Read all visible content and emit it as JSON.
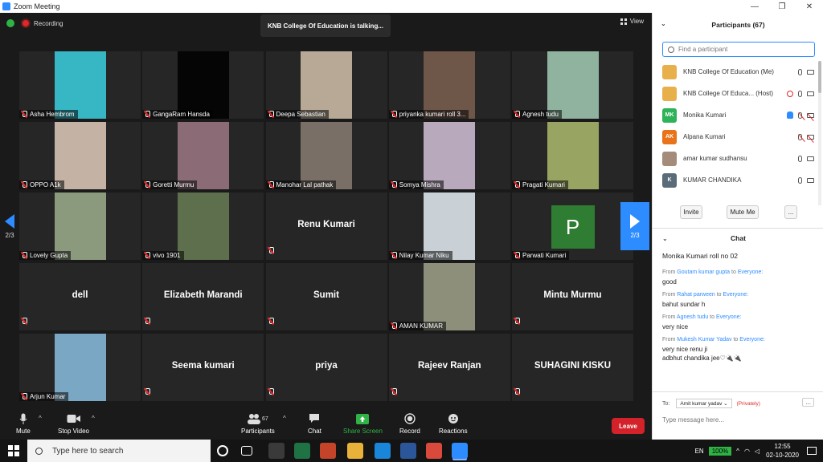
{
  "window": {
    "title": "Zoom Meeting",
    "controls": [
      "—",
      "❐",
      "✕"
    ]
  },
  "status": {
    "recording": "Recording",
    "talking": "KNB College Of Education is talking...",
    "view": "View"
  },
  "tiles": [
    {
      "name": "Asha Hembrom",
      "type": "video",
      "color": "#37b6c4"
    },
    {
      "name": "GangaRam Hansda",
      "type": "video",
      "color": "#050505"
    },
    {
      "name": "Deepa Sebastian",
      "type": "video",
      "color": "#b7a996"
    },
    {
      "name": "priyanka kumari roll 3...",
      "type": "video",
      "color": "#6e5648"
    },
    {
      "name": "Agnesh tudu",
      "type": "video",
      "color": "#8fb39e"
    },
    {
      "name": "OPPO A1k",
      "type": "video",
      "color": "#c4b3a5"
    },
    {
      "name": "Goretti Murmu",
      "type": "video",
      "color": "#8b6c76"
    },
    {
      "name": "Manohar Lal pathak",
      "type": "video",
      "color": "#7a6f66"
    },
    {
      "name": "Somya Mishra",
      "type": "video",
      "color": "#b9a9bd"
    },
    {
      "name": "Pragati Kumari",
      "type": "video",
      "color": "#98a461"
    },
    {
      "name": "Lovely Gupta",
      "type": "video",
      "color": "#8b9a7d"
    },
    {
      "name": "vivo 1901",
      "type": "video",
      "color": "#5d6f4d"
    },
    {
      "name": "Renu Kumari",
      "type": "text"
    },
    {
      "name": "Nilay Kumar Niku",
      "type": "video",
      "color": "#c9d1d6"
    },
    {
      "name": "Parwati Kumari",
      "type": "avatar",
      "letter": "P"
    },
    {
      "name": "dell",
      "type": "text"
    },
    {
      "name": "Elizabeth Marandi",
      "type": "text"
    },
    {
      "name": "Sumit",
      "type": "text"
    },
    {
      "name": "AMAN KUMAR",
      "type": "video",
      "color": "#8d8f7a"
    },
    {
      "name": "Mintu Murmu",
      "type": "text"
    },
    {
      "name": "Arjun Kumar",
      "type": "video",
      "color": "#7aa7c4"
    },
    {
      "name": "Seema kumari",
      "type": "text"
    },
    {
      "name": "priya",
      "type": "text"
    },
    {
      "name": "Rajeev Ranjan",
      "type": "text"
    },
    {
      "name": "SUHAGINI KISKU",
      "type": "text"
    }
  ],
  "pager": {
    "left": "2/3",
    "right": "2/3"
  },
  "toolbar": {
    "mute": "Mute",
    "stop_video": "Stop Video",
    "participants": "Participants",
    "participants_count": "67",
    "chat": "Chat",
    "share_screen": "Share Screen",
    "record": "Record",
    "reactions": "Reactions",
    "leave": "Leave"
  },
  "participants_panel": {
    "title": "Participants (67)",
    "search_placeholder": "Find a participant",
    "list": [
      {
        "name": "KNB College Of Education (Me)",
        "initials": "",
        "avatar_color": "#e8b04a",
        "icons": [
          "mic",
          "cam"
        ]
      },
      {
        "name": "KNB College Of Educa... (Host)",
        "initials": "",
        "avatar_color": "#e8b04a",
        "icons": [
          "rec",
          "mic",
          "cam"
        ]
      },
      {
        "name": "Monika Kumari",
        "initials": "MK",
        "avatar_color": "#2fb35a",
        "icons": [
          "hand",
          "mic-off",
          "cam-off"
        ]
      },
      {
        "name": "Alpana Kumari",
        "initials": "AK",
        "avatar_color": "#e8731a",
        "icons": [
          "mic-off",
          "cam-off"
        ]
      },
      {
        "name": "amar kumar sudhansu",
        "initials": "",
        "avatar_color": "#a58b7a",
        "icons": [
          "mic",
          "cam"
        ]
      },
      {
        "name": "KUMAR CHANDIKA",
        "initials": "K",
        "avatar_color": "#5a6b7a",
        "icons": [
          "mic",
          "cam"
        ]
      }
    ],
    "invite": "Invite",
    "mute_me": "Mute Me",
    "more": "..."
  },
  "chat_panel": {
    "title": "Chat",
    "first_message": "Monika Kumari roll no 02",
    "messages": [
      {
        "from": "Goutam kumar gupta",
        "to": "Everyone:",
        "lines": [
          "good"
        ]
      },
      {
        "from": "Rahat parween",
        "to": "Everyone:",
        "lines": [
          "bahut sundar h"
        ]
      },
      {
        "from": "Agnesh tudu",
        "to": "Everyone:",
        "lines": [
          "very nice"
        ]
      },
      {
        "from": "Mukesh Kumar Yadav",
        "to": "Everyone:",
        "lines": [
          "very nice renu ji",
          "adbhut chandika jee♡🔌🔌"
        ]
      }
    ],
    "from_prefix": "From",
    "to_word": "to",
    "to_label": "To:",
    "recipient": "Amit kumar yadav ⌄",
    "privately": "(Privately)",
    "more": "...",
    "input_placeholder": "Type message here..."
  },
  "taskbar": {
    "search_placeholder": "Type here to search",
    "lang": "EN",
    "battery": "100%",
    "time": "12:55",
    "date": "02-10-2020",
    "apps": [
      {
        "name": "cortana",
        "color": "#141414"
      },
      {
        "name": "task-view",
        "color": "#141414"
      },
      {
        "name": "store",
        "color": "#3a3a3a"
      },
      {
        "name": "excel",
        "color": "#1f7244"
      },
      {
        "name": "powerpoint",
        "color": "#c4442a"
      },
      {
        "name": "file-explorer",
        "color": "#e8b23a"
      },
      {
        "name": "edge",
        "color": "#1a86d9"
      },
      {
        "name": "word",
        "color": "#2b579a"
      },
      {
        "name": "chrome",
        "color": "#d94a3d"
      },
      {
        "name": "zoom",
        "color": "#2d8cff"
      }
    ]
  }
}
